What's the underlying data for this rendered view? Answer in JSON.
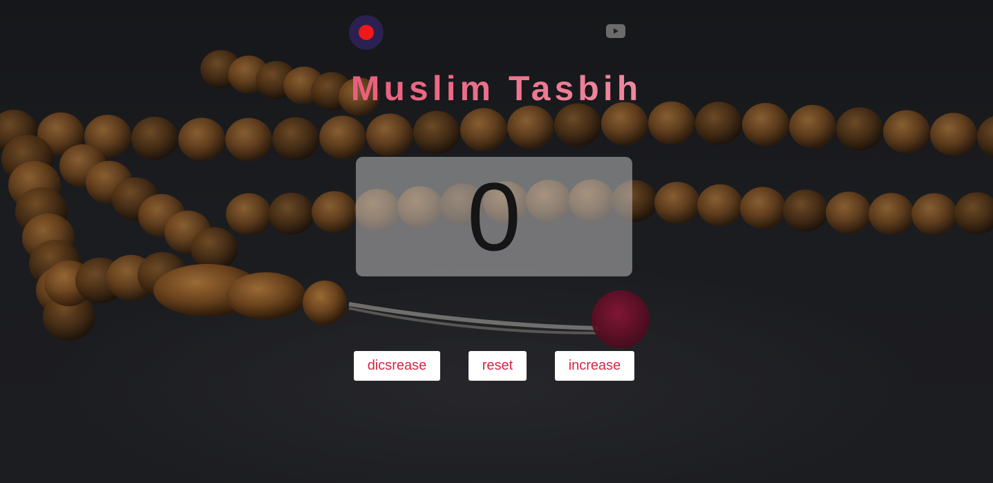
{
  "header": {
    "title": "Muslim Tasbih",
    "record_icon": "record-icon",
    "youtube_icon": "youtube-icon"
  },
  "counter": {
    "value": "0"
  },
  "controls": {
    "decrease_label": "dicsrease",
    "reset_label": "reset",
    "increase_label": "increase"
  },
  "colors": {
    "title_gradient_start": "#e2385c",
    "title_gradient_end": "#f7c3cc",
    "button_text": "#d02745",
    "record_dot": "#f01818",
    "record_bg": "#2a2150"
  }
}
